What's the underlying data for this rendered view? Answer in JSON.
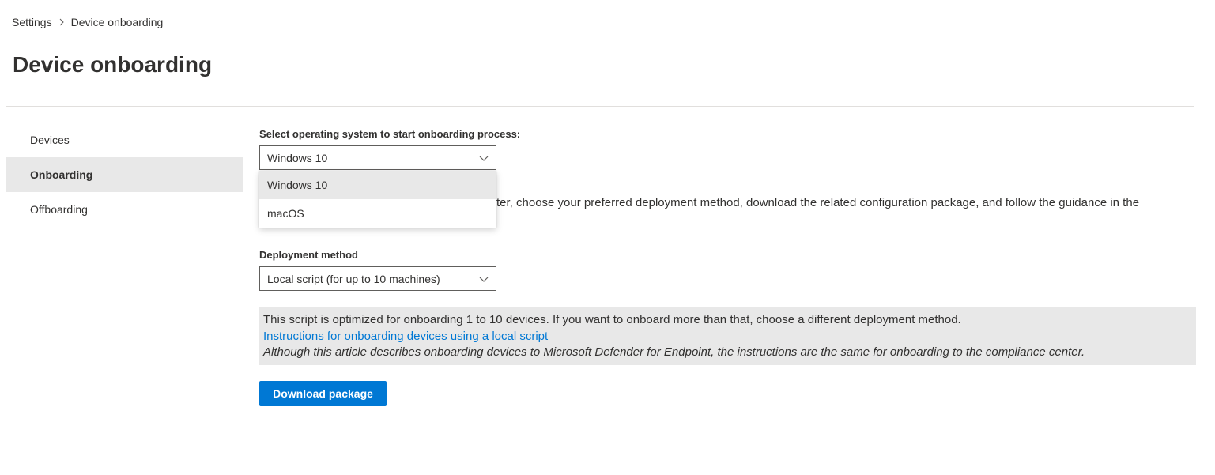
{
  "breadcrumb": {
    "items": [
      "Settings",
      "Device onboarding"
    ]
  },
  "page": {
    "title": "Device onboarding"
  },
  "sidebar": {
    "items": [
      {
        "label": "Devices",
        "active": false
      },
      {
        "label": "Onboarding",
        "active": true
      },
      {
        "label": "Offboarding",
        "active": false
      }
    ]
  },
  "os_select": {
    "label": "Select operating system to start onboarding process:",
    "value": "Windows 10",
    "options": [
      "Windows 10",
      "macOS"
    ],
    "expanded": true
  },
  "description": {
    "visible_text": "ter, choose your preferred deployment method, download the related configuration package, and follow the guidance in the"
  },
  "deployment": {
    "label": "Deployment method",
    "value": "Local script (for up to 10 machines)"
  },
  "info": {
    "text": "This script is optimized for onboarding 1 to 10 devices. If you want to onboard more than that, choose a different deployment method.",
    "link": "Instructions for onboarding devices using a local script",
    "note": "Although this article describes onboarding devices to Microsoft Defender for Endpoint, the instructions are the same for onboarding to the compliance center."
  },
  "actions": {
    "download_label": "Download package"
  },
  "colors": {
    "accent": "#0078d4",
    "selected_bg": "#e8e8e8",
    "text": "#323130"
  },
  "icons": [
    "chevron-right-icon",
    "chevron-down-icon"
  ]
}
